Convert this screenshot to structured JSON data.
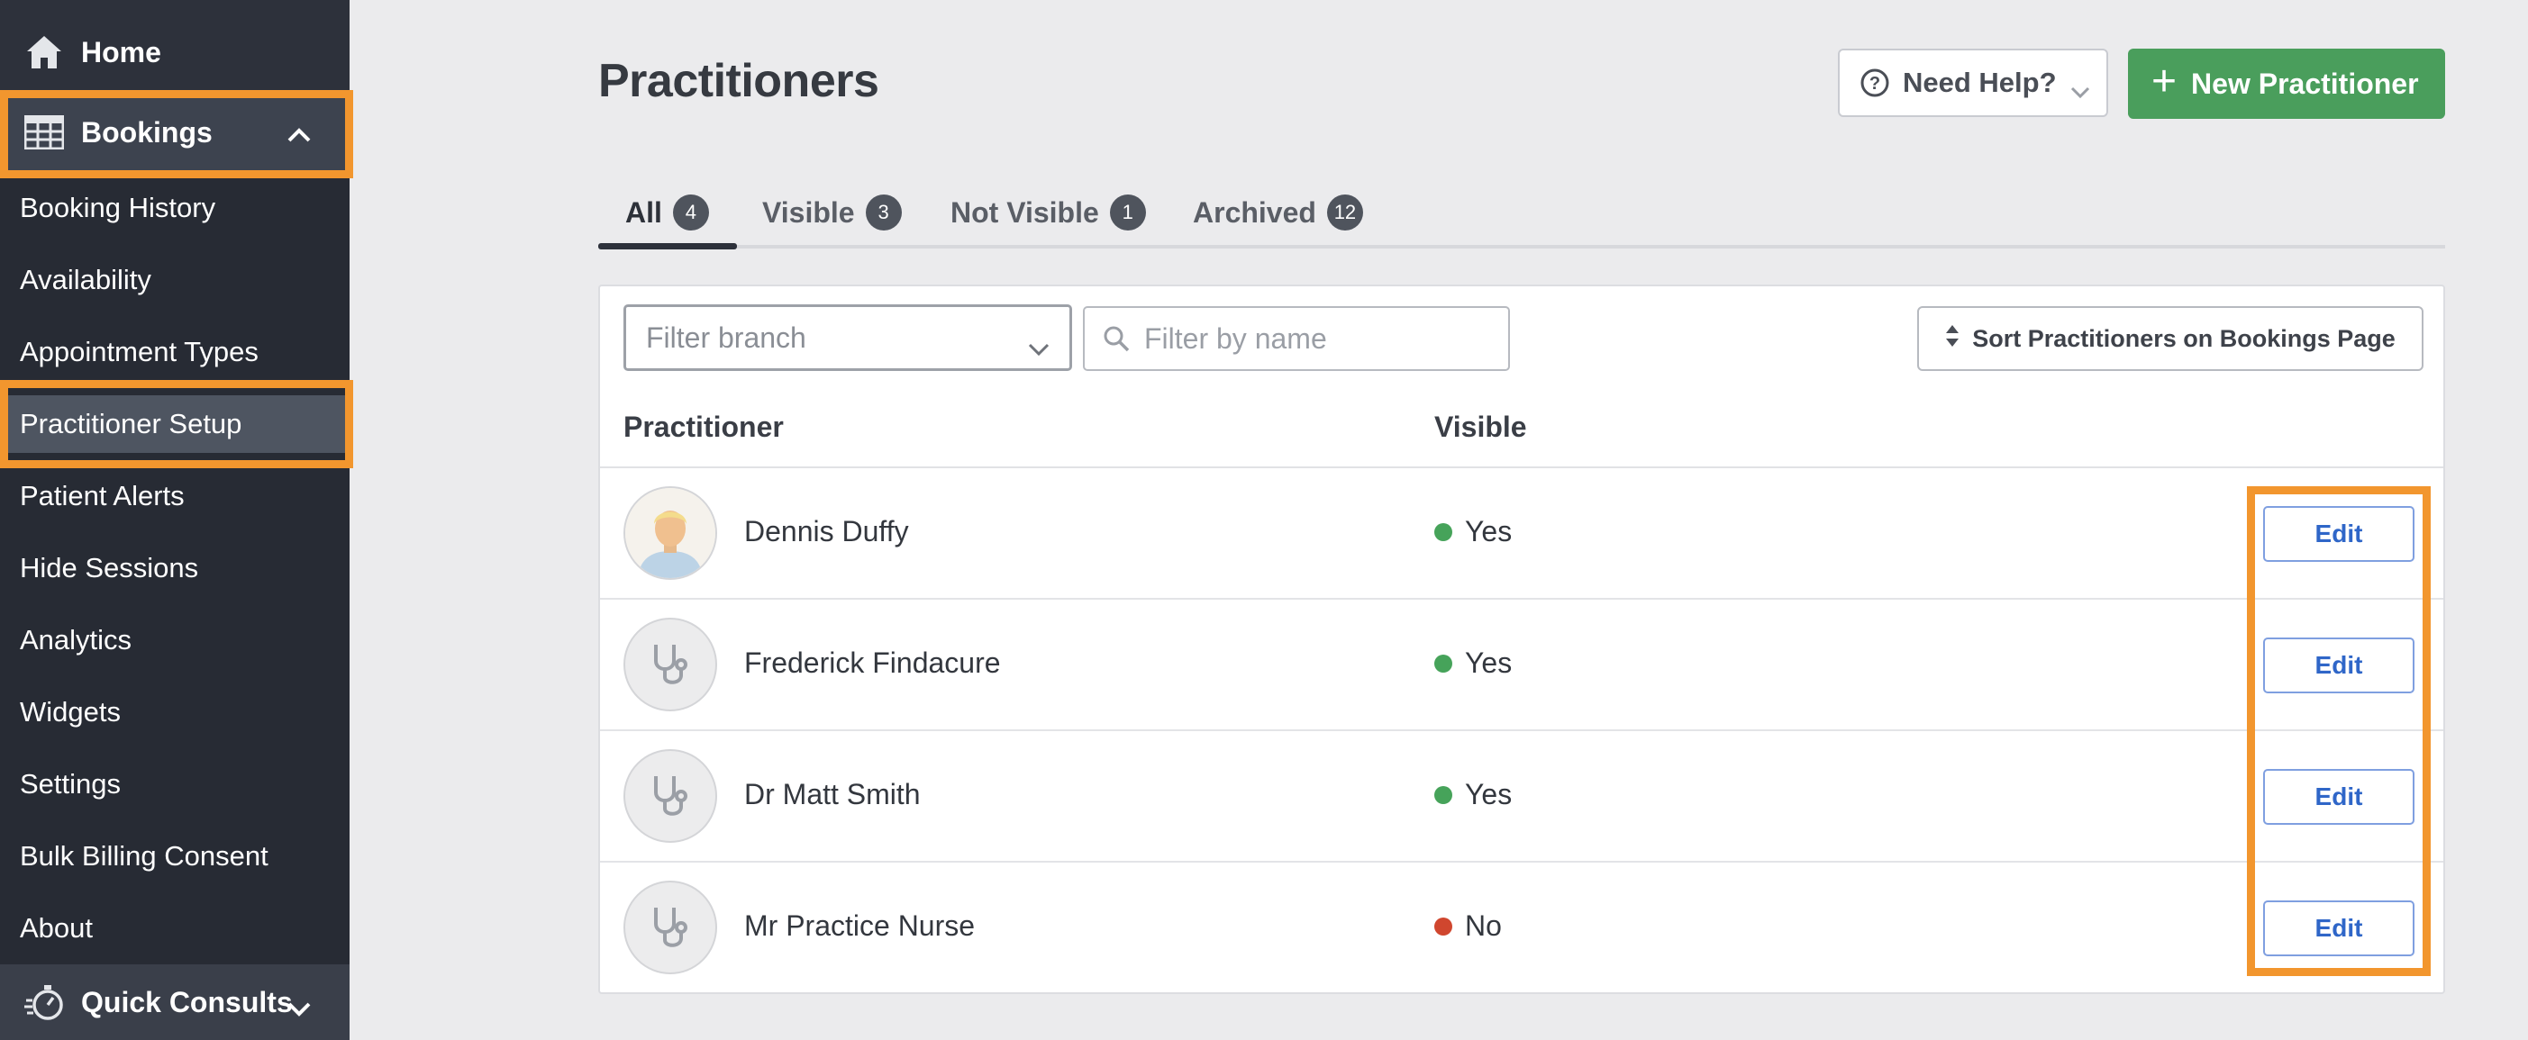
{
  "sidebar": {
    "home": {
      "label": "Home",
      "icon": "home-icon"
    },
    "bookings": {
      "label": "Bookings",
      "icon": "calendar-grid-icon",
      "expanded": true
    },
    "items": [
      {
        "label": "Booking History"
      },
      {
        "label": "Availability"
      },
      {
        "label": "Appointment Types"
      },
      {
        "label": "Practitioner Setup",
        "active": true
      },
      {
        "label": "Patient Alerts"
      },
      {
        "label": "Hide Sessions"
      },
      {
        "label": "Analytics"
      },
      {
        "label": "Widgets"
      },
      {
        "label": "Settings"
      },
      {
        "label": "Bulk Billing Consent"
      },
      {
        "label": "About"
      }
    ],
    "quick_consults": {
      "label": "Quick Consults",
      "icon": "stopwatch-icon"
    }
  },
  "header": {
    "title": "Practitioners",
    "help_label": "Need Help?",
    "new_label": "New Practitioner"
  },
  "tabs": [
    {
      "label": "All",
      "count": "4",
      "active": true
    },
    {
      "label": "Visible",
      "count": "3"
    },
    {
      "label": "Not Visible",
      "count": "1"
    },
    {
      "label": "Archived",
      "count": "12"
    }
  ],
  "filters": {
    "branch_placeholder": "Filter branch",
    "name_placeholder": "Filter by name",
    "sort_label": "Sort Practitioners on Bookings Page"
  },
  "table": {
    "columns": [
      "Practitioner",
      "Visible"
    ],
    "rows": [
      {
        "name": "Dennis Duffy",
        "visible": "Yes",
        "avatar": "person-photo",
        "edit": "Edit"
      },
      {
        "name": "Frederick Findacure",
        "visible": "Yes",
        "avatar": "stethoscope-icon",
        "edit": "Edit"
      },
      {
        "name": "Dr Matt Smith",
        "visible": "Yes",
        "avatar": "stethoscope-icon",
        "edit": "Edit"
      },
      {
        "name": "Mr Practice Nurse",
        "visible": "No",
        "avatar": "stethoscope-icon",
        "edit": "Edit"
      }
    ]
  },
  "colors": {
    "highlight": "#f2962e",
    "primary_green": "#4a9e5c",
    "status_yes": "#46a35a",
    "status_no": "#d0462e",
    "edit_blue": "#2f66c8",
    "sidebar_bg": "#2d313b"
  }
}
